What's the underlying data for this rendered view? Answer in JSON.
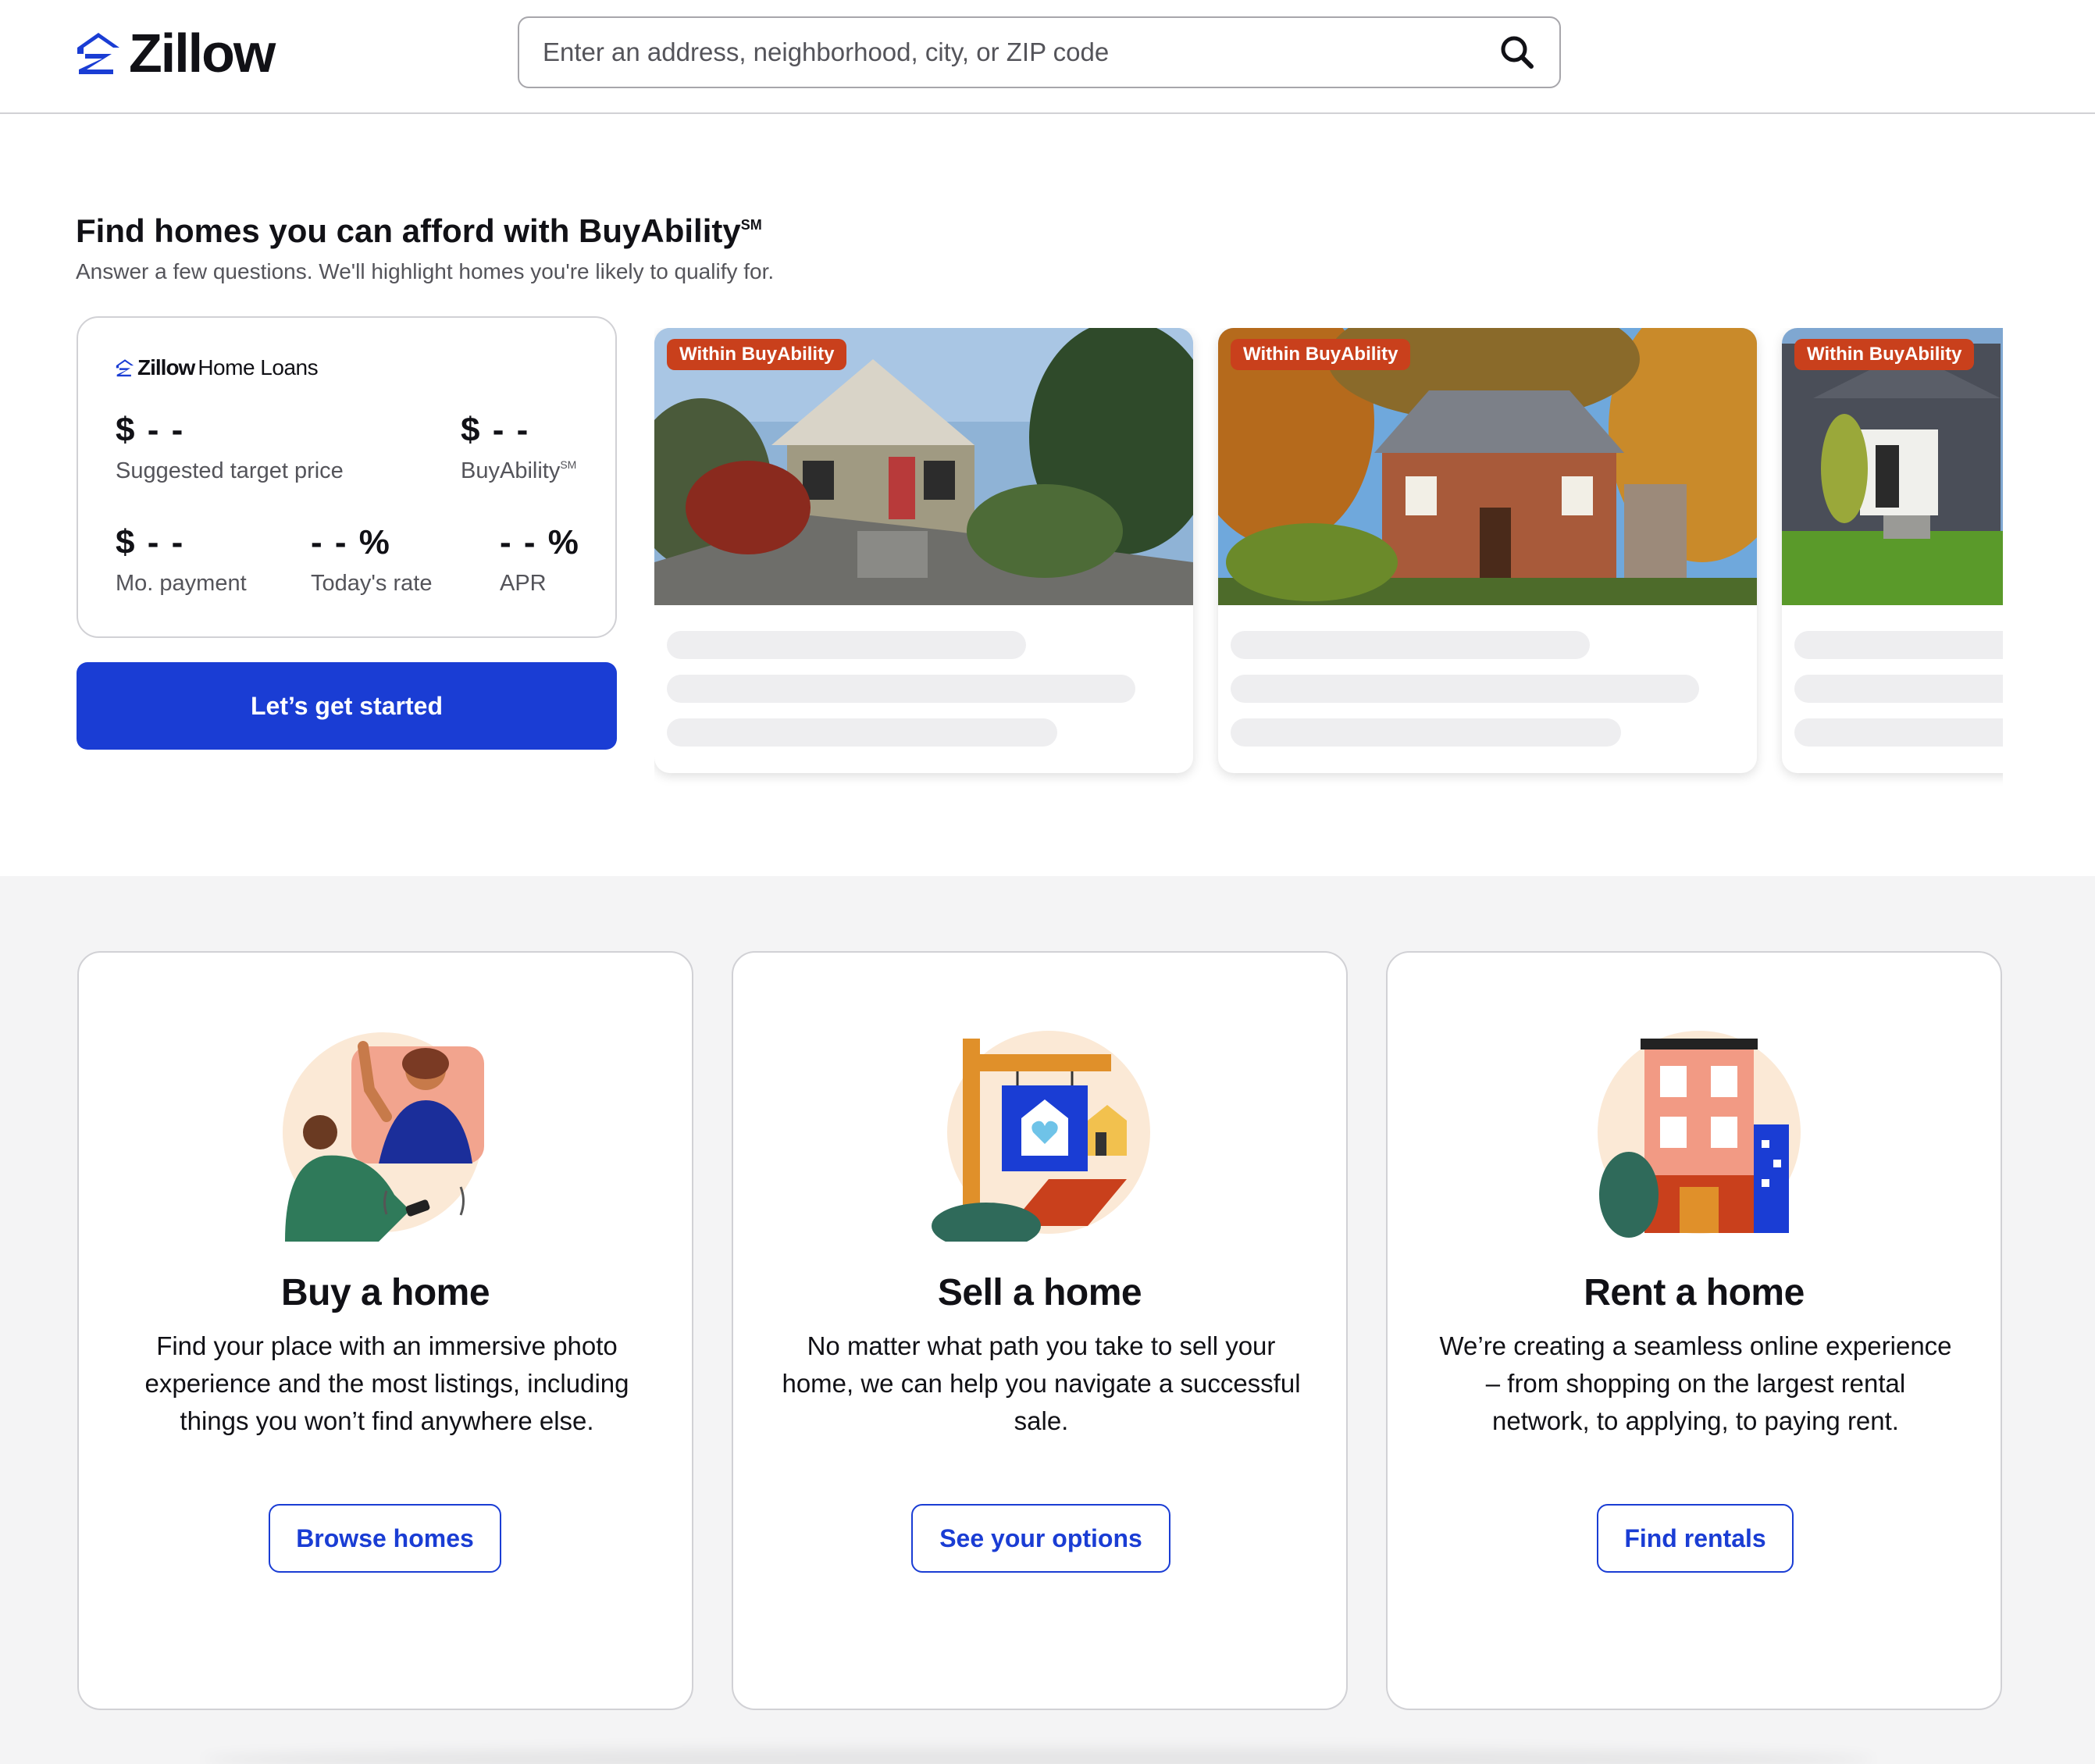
{
  "header": {
    "logo_text": "Zillow",
    "search_placeholder": "Enter an address, neighborhood, city, or ZIP code",
    "search_icon": "search-icon"
  },
  "buyability": {
    "title": "Find homes you can afford with BuyAbility",
    "title_mark": "SM",
    "subtitle": "Answer a few questions. We'll highlight homes you're likely to qualify for.",
    "card": {
      "logo_brand": "Zillow",
      "logo_sub": "Home Loans",
      "target_price": {
        "value": "$ - -",
        "label": "Suggested target price"
      },
      "buyability": {
        "value": "$ - -",
        "label": "BuyAbility",
        "mark": "SM"
      },
      "payment": {
        "value": "$ - -",
        "label": "Mo. payment"
      },
      "rate": {
        "value": "- - %",
        "label": "Today's rate"
      },
      "apr": {
        "value": "- - %",
        "label": "APR"
      }
    },
    "cta_label": "Let’s get started",
    "listings": [
      {
        "badge": "Within BuyAbility"
      },
      {
        "badge": "Within BuyAbility"
      },
      {
        "badge": "Within BuyAbility"
      }
    ]
  },
  "options": [
    {
      "title": "Buy a home",
      "description": "Find your place with an immersive photo experience and the most listings, including things you won’t find anywhere else.",
      "button": "Browse homes"
    },
    {
      "title": "Sell a home",
      "description": "No matter what path you take to sell your home, we can help you navigate a successful sale.",
      "button": "See your options"
    },
    {
      "title": "Rent a home",
      "description": "We’re creating a seamless online experience – from shopping on the largest rental network, to applying, to paying rent.",
      "button": "Find rentals"
    }
  ],
  "colors": {
    "brand_blue": "#1a3dd4",
    "badge_orange": "#c9401c",
    "section_gray": "#f4f4f5"
  }
}
